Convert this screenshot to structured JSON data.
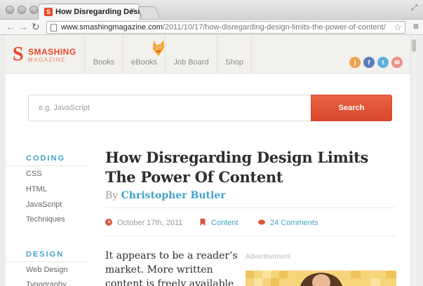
{
  "browser": {
    "tab_title": "How Disregarding Design",
    "tab_close": "✕",
    "url_host": "www.smashingmagazine.com",
    "url_path": "/2011/10/17/how-disregarding-design-limits-the-power-of-content/"
  },
  "site": {
    "logo_word1": "SMASHING",
    "logo_word2": "MAGAZINE",
    "nav": [
      "Books",
      "eBooks",
      "Job Board",
      "Shop"
    ],
    "social_icons": [
      "rss-icon",
      "facebook-icon",
      "twitter-icon",
      "email-icon"
    ],
    "brand_color": "#e8472a",
    "accent_color": "#41a3c9"
  },
  "search": {
    "placeholder": "e.g. JavaScript",
    "button": "Search"
  },
  "sidebar": {
    "sections": [
      {
        "heading": "CODING",
        "links": [
          "CSS",
          "HTML",
          "JavaScript",
          "Techniques"
        ]
      },
      {
        "heading": "DESIGN",
        "links": [
          "Web Design",
          "Typography"
        ]
      }
    ]
  },
  "article": {
    "title": "How Disregarding Design Limits The Power Of Content",
    "by": "By",
    "author": "Christopher Butler",
    "date": "October 17th, 2011",
    "category": "Content",
    "comments": "24 Comments",
    "intro": "It appears to be a reader’s market. More written content is freely available"
  },
  "ad": {
    "label": "Advertisement"
  }
}
